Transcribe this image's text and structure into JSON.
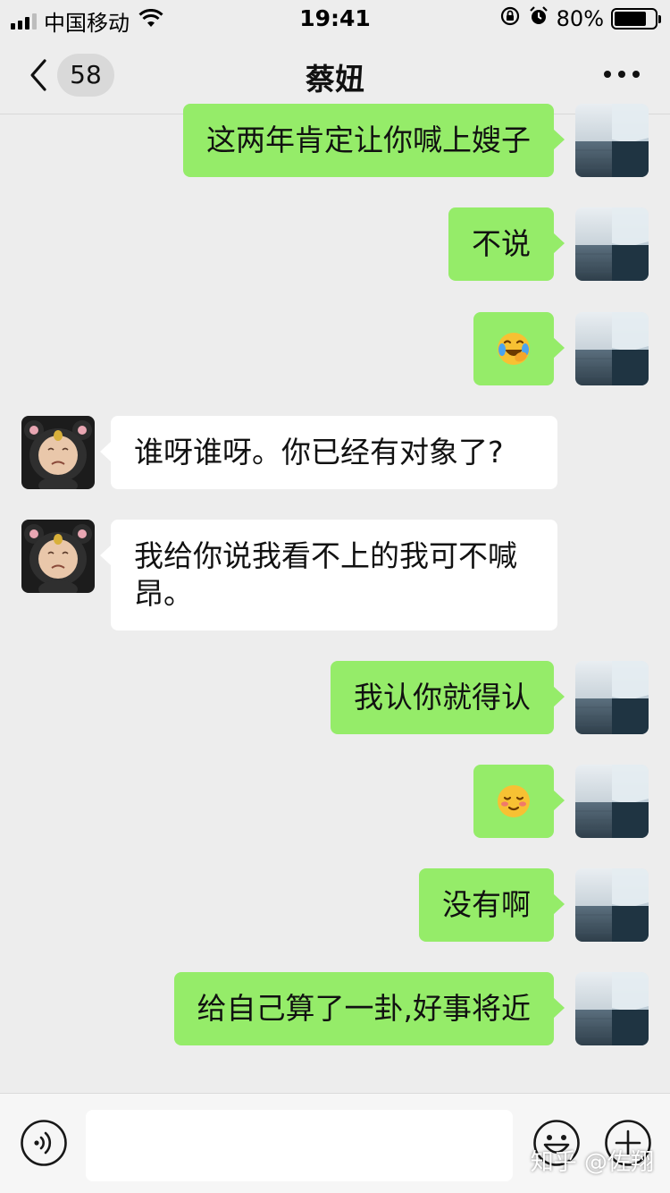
{
  "status_bar": {
    "carrier": "中国移动",
    "time": "19:41",
    "battery_percent": 80,
    "battery_label": "80%",
    "icons": [
      "signal-icon",
      "wifi-icon",
      "orientation-lock-icon",
      "alarm-icon",
      "battery-icon"
    ]
  },
  "nav": {
    "back_icon": "chevron-left-icon",
    "unread_count": "58",
    "title": "蔡妞",
    "more_icon": "more-dots-icon"
  },
  "messages": [
    {
      "from": "me",
      "text": "这两年肯定让你喊上嫂子"
    },
    {
      "from": "me",
      "text": "不说"
    },
    {
      "from": "me",
      "emoji": "laughing-tears-emoji"
    },
    {
      "from": "them",
      "text": "谁呀谁呀。你已经有对象了?"
    },
    {
      "from": "them",
      "text": "我给你说我看不上的我可不喊",
      "text2": "昂。"
    },
    {
      "from": "me",
      "text": "我认你就得认"
    },
    {
      "from": "me",
      "emoji": "blushing-emoji"
    },
    {
      "from": "me",
      "text": "没有啊"
    },
    {
      "from": "me",
      "text": "给自己算了一卦,好事将近"
    }
  ],
  "input_bar": {
    "voice_icon": "voice-icon",
    "input_value": "",
    "emoji_icon": "smiley-icon",
    "plus_icon": "plus-icon"
  },
  "watermark": "知乎 @佐翔",
  "colors": {
    "background": "#ededed",
    "my_bubble": "#95ec69",
    "their_bubble": "#ffffff",
    "badge": "#d9d9d9"
  }
}
